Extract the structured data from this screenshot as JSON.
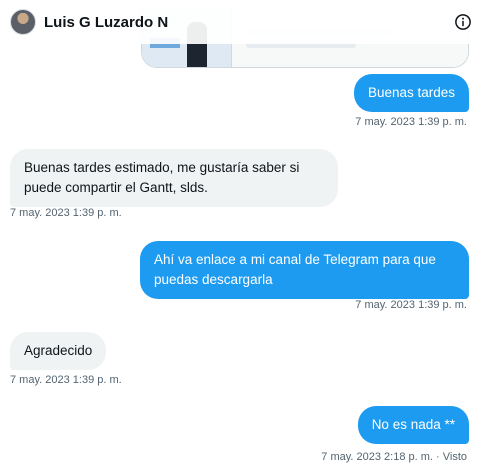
{
  "header": {
    "contact_name": "Luis G Luzardo N",
    "icons": {
      "info": "info-circle-icon",
      "avatar": "user-avatar"
    }
  },
  "messages": [
    {
      "direction": "out",
      "text": "Buenas tardes",
      "timestamp": "7 may. 2023 1:39 p. m."
    },
    {
      "direction": "in",
      "text": "Buenas tardes estimado, me gustaría saber si puede compartir el Gantt, slds.",
      "timestamp": "7 may. 2023 1:39 p. m."
    },
    {
      "direction": "out",
      "text": "Ahí va enlace a mi canal de Telegram para que puedas descargarla",
      "timestamp": "7 may. 2023 1:39 p. m."
    },
    {
      "direction": "in",
      "text": "Agradecido",
      "timestamp": "7 may. 2023 1:39 p. m."
    },
    {
      "direction": "out",
      "text": "No es nada **",
      "timestamp": "7 may. 2023 2:18 p. m. · Visto"
    }
  ],
  "colors": {
    "outgoing": "#1d9bf0",
    "incoming": "#eff3f4",
    "timestamp": "#536471"
  }
}
